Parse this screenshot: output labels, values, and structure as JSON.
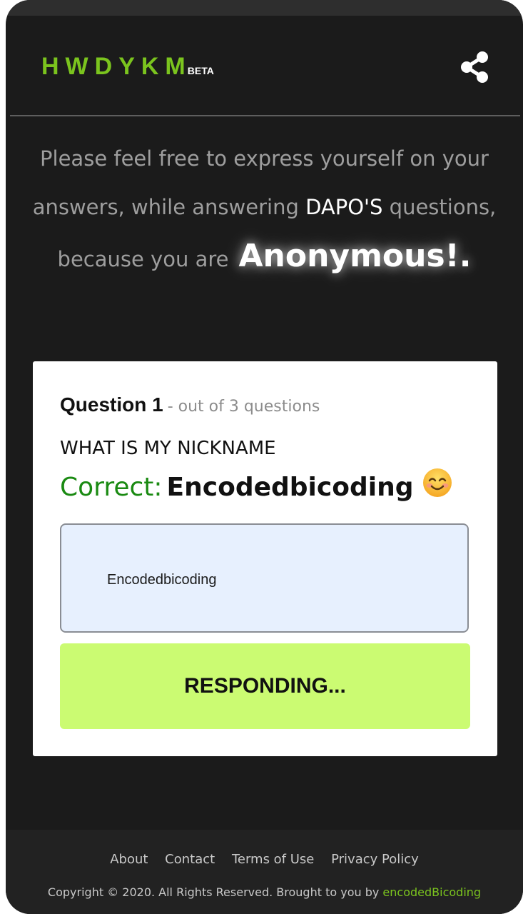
{
  "header": {
    "logo_text": "HWDYKM",
    "logo_badge": "BETA",
    "share_icon": "share-icon"
  },
  "intro": {
    "line1": "Please feel free to express yourself on your",
    "line2_before": "answers, while answering ",
    "owner_name": "DAPO'S",
    "line2_after": " questions,",
    "line3_before": "because you are",
    "line3_highlight": "Anonymous!."
  },
  "question": {
    "title": "Question 1",
    "subtitle": "- out of 3 questions",
    "text": "WHAT IS MY NICKNAME",
    "result_label": "Correct:",
    "result_answer": "Encodedbicoding",
    "result_emoji": "smiling-face-icon"
  },
  "answer": {
    "value": "Encodedbicoding"
  },
  "submit": {
    "label": "RESPONDING..."
  },
  "footer": {
    "links": [
      "About",
      "Contact",
      "Terms of Use",
      "Privacy Policy"
    ],
    "copyright_text": "Copyright © 2020. All Rights Reserved. Brought to you by ",
    "copyright_brand": "encodedBicoding"
  },
  "colors": {
    "background": "#1b1b1b",
    "logo_green": "#7bc41e",
    "button_green": "#cbfb72",
    "correct_green": "#1a8a12",
    "input_bg": "#e7f0fe"
  }
}
